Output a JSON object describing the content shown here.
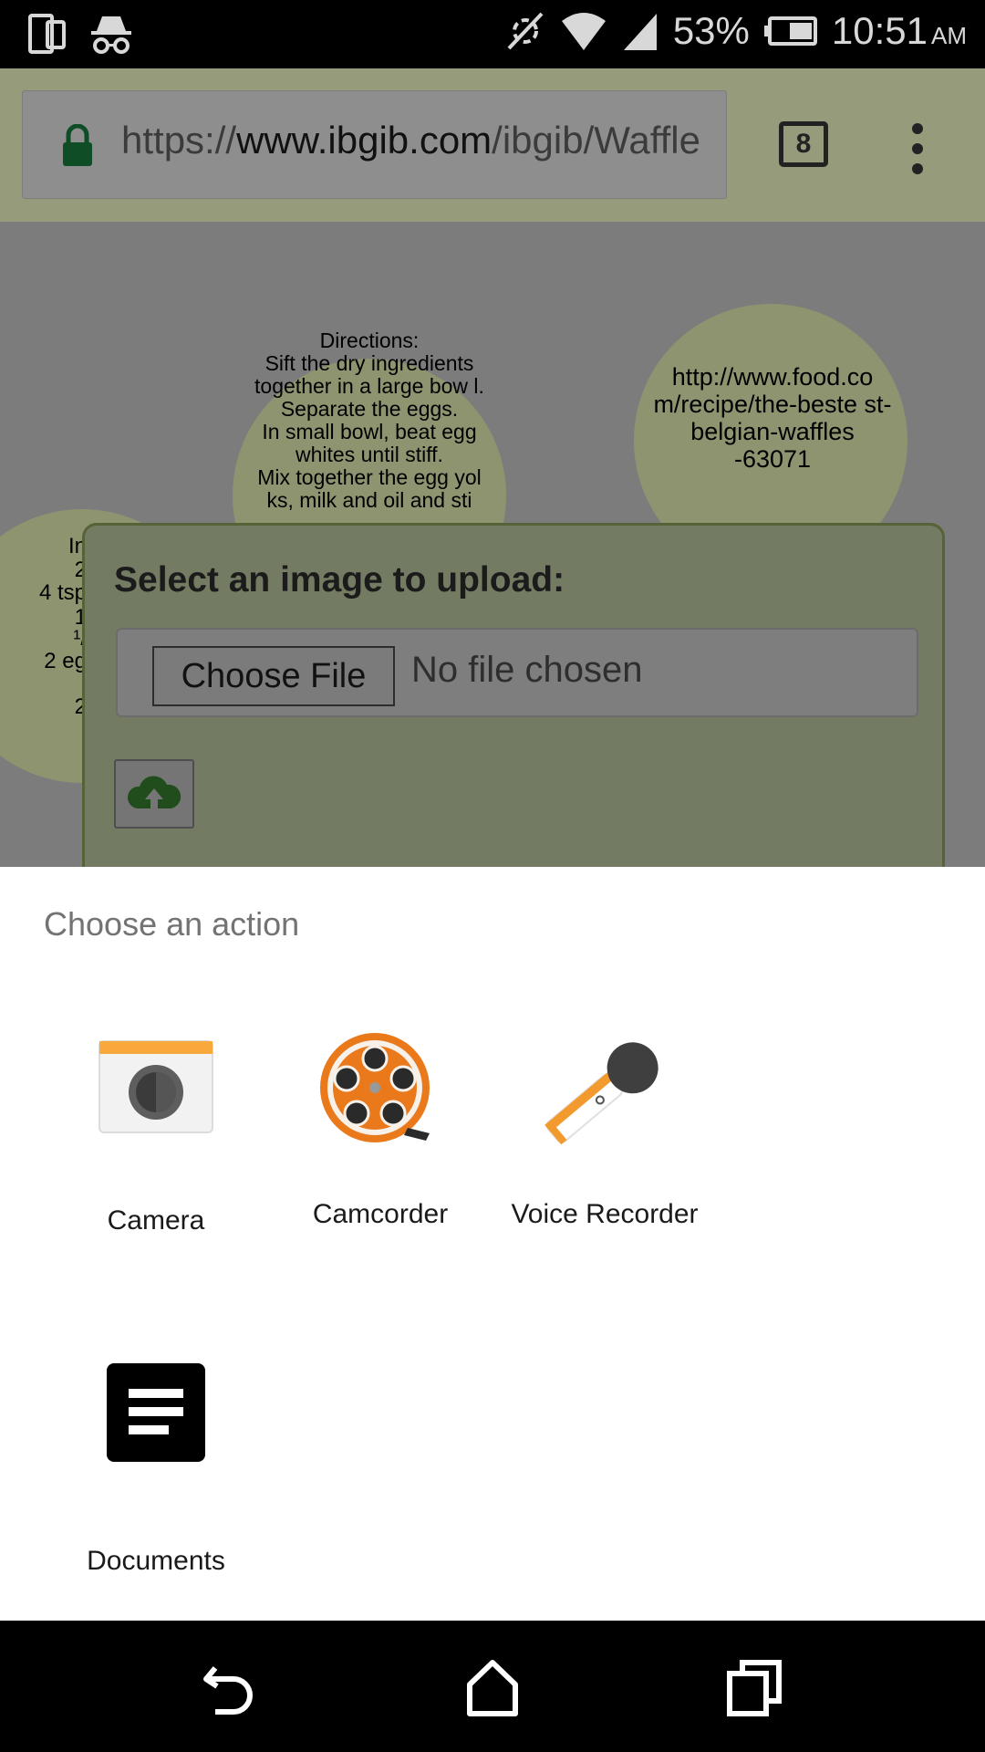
{
  "status_bar": {
    "battery_percent": "53%",
    "time": "10:51",
    "ampm": "AM",
    "icons": [
      "tablet-icon",
      "incognito-icon",
      "nfc-off-icon",
      "wifi-icon",
      "signal-icon",
      "battery-icon"
    ]
  },
  "browser": {
    "url_scheme": "https://",
    "url_host": "www.ibgib.com",
    "url_path": "/ibgib/Waffle",
    "tab_count": "8"
  },
  "page": {
    "directions_text": "Directions:\nSift the dry ingredients together in a large bow l.\nSeparate the eggs.\nIn small bowl, beat egg whites until stiff.\nMix together the egg yol ks, milk and oil and sti",
    "url_node_text": "http://www.food.co m/recipe/the-beste st-belgian-waffles -63071",
    "ingredients_fragments": [
      "In",
      "2",
      "4 tsp",
      "1",
      "¹/",
      "2 eg",
      "2"
    ],
    "upload_dialog": {
      "title": "Select an image to upload:",
      "choose_file_label": "Choose File",
      "no_file_text": "No file chosen"
    }
  },
  "sheet": {
    "title": "Choose an action",
    "actions": [
      {
        "label": "Camera",
        "icon": "camera-icon"
      },
      {
        "label": "Camcorder",
        "icon": "camcorder-icon"
      },
      {
        "label": "Voice Recorder",
        "icon": "microphone-icon"
      },
      {
        "label": "Documents",
        "icon": "documents-icon"
      }
    ]
  },
  "colors": {
    "camera_accent": "#f9a83b",
    "camcorder_orange": "#e9791a",
    "mic_orange": "#f29a2e",
    "lock_green": "#0e4d26"
  }
}
